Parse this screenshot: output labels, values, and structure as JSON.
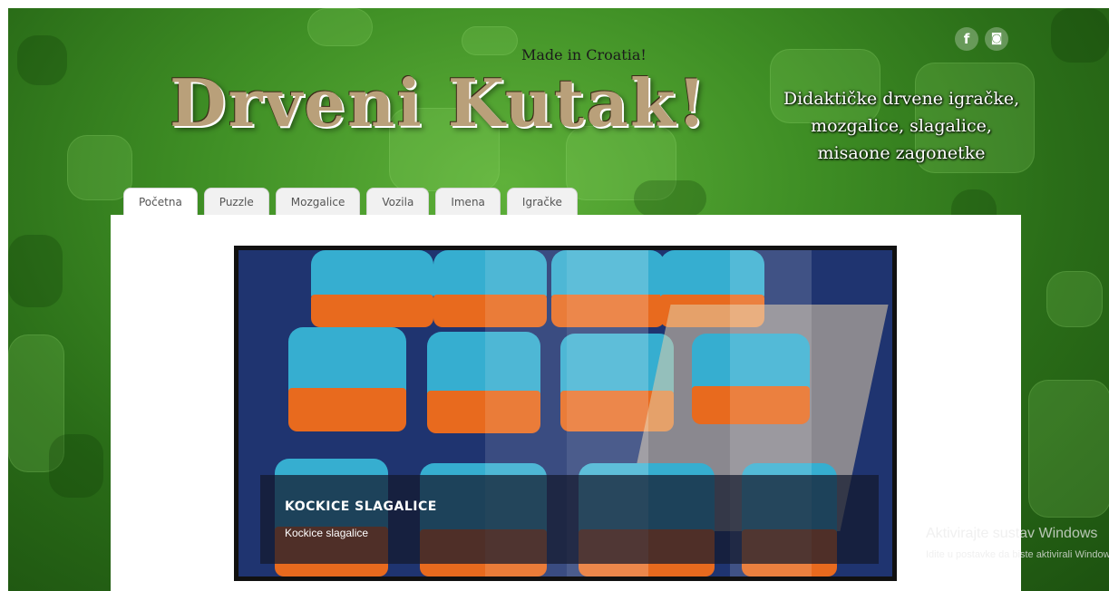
{
  "header": {
    "made_in": "Made in Croatia!",
    "logo_text": "Drveni Kutak!",
    "tagline": [
      "Didaktičke drvene igračke,",
      "mozgalice, slagalice,",
      "misaone zagonetke"
    ],
    "social": [
      {
        "icon": "facebook-icon",
        "glyph": "f"
      },
      {
        "icon": "instagram-icon",
        "glyph": "◙"
      }
    ]
  },
  "nav": {
    "tabs": [
      "Početna",
      "Puzzle",
      "Mozgalice",
      "Vozila",
      "Imena",
      "Igračke"
    ]
  },
  "slider": {
    "caption_title": "KOCKICE SLAGALICE",
    "caption_text": "Kockice slagalice"
  },
  "watermark": {
    "title": "Aktivirajte sustav Windows",
    "subtitle": "Idite u postavke da biste aktivirali Windows."
  },
  "colors": {
    "background_green": "#3f8f25",
    "block_blue": "#36aed0",
    "block_orange": "#e86a1e",
    "photo_bg": "#1f3470"
  }
}
